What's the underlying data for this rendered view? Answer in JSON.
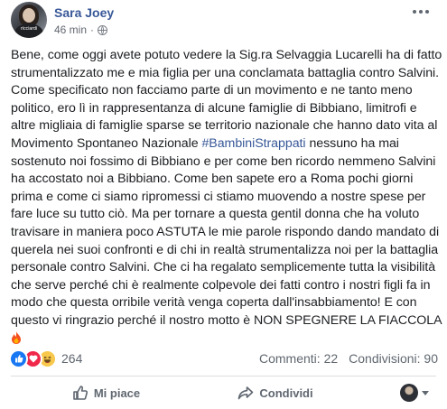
{
  "post": {
    "author": "Sara Joey",
    "time": "46 min",
    "separator": "·",
    "avatar_caption": "ricciardi",
    "visibility_icon": "globe-icon",
    "body_part1": "Bene, come oggi avete potuto vedere la Sig.ra Selvaggia Lucarelli ha di fatto strumentalizzato me e mia figlia per una conclamata battaglia contro Salvini. Come specificato non facciamo parte di un movimento e ne tanto meno politico, ero lì in rappresentanza di alcune famiglie di Bibbiano, limitrofi e altre migliaia di famiglie sparse se territorio nazionale che hanno dato vita al Movimento Spontaneo Nazionale ",
    "hashtag": "#BambiniStrappati",
    "body_part2": " nessuno ha mai sostenuto noi fossimo di Bibbiano e per come ben ricordo nemmeno Salvini ha accostato noi a Bibbiano. Come ben sapete ero a Roma pochi giorni prima e come ci siamo ripromessi ci stiamo muovendo a nostre spese per fare luce su tutto ciò. Ma per tornare a questa gentil donna che ha voluto travisare in maniera poco ASTUTA le mie parole rispondo dando mandato di querela nei suoi confronti e di chi in realtà strumentalizza noi per la battaglia personale contro Salvini. Che ci ha regalato semplicemente tutta la visibilità che serve perché chi è realmente colpevole dei fatti contro i nostri figli fa in modo che questa orribile verità venga coperta dall'insabbiamento! E con questo vi ringrazio perché il nostro motto è NON SPEGNERE LA FIACCOLA"
  },
  "reactions": {
    "types": [
      "like",
      "love",
      "haha"
    ],
    "count": "264"
  },
  "stats": {
    "comments": "Commenti: 22",
    "shares": "Condivisioni: 90"
  },
  "actions": {
    "like_label": "Mi piace",
    "share_label": "Condividi"
  },
  "colors": {
    "link": "#385898",
    "like": "#1877f2",
    "love": "#f0284a",
    "haha": "#f7c84b",
    "muted": "#606770"
  }
}
